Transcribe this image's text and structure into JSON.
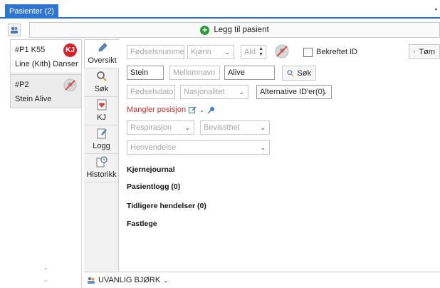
{
  "tab": {
    "label": "Pasienter (2)"
  },
  "toolbar": {
    "add_patient_label": "Legg til pasient"
  },
  "patients": [
    {
      "id": "#P1 K55",
      "name": "Line (Kith) Danser",
      "badge": "KJ"
    },
    {
      "id": "#P2",
      "name": "Stein Alive",
      "badge": "no-position"
    }
  ],
  "nav": [
    {
      "label": "Oversikt",
      "icon": "pencil-icon"
    },
    {
      "label": "Søk",
      "icon": "magnifier-icon"
    },
    {
      "label": "KJ",
      "icon": "heart-document-icon"
    },
    {
      "label": "Logg",
      "icon": "edit-document-icon"
    },
    {
      "label": "Historikk",
      "icon": "history-icon"
    }
  ],
  "form": {
    "fodselsnummer_placeholder": "Fødselsnummer",
    "kjonn_placeholder": "Kjønn",
    "alder_placeholder": "Ald",
    "bekreftet_label": "Bekreftet ID",
    "tom_label": "Tøm",
    "fornavn_value": "Stein",
    "mellomnavn_placeholder": "Mellomnavn",
    "etternavn_value": "Alive",
    "sok_label": "Søk",
    "fodselsdato_placeholder": "Fødselsdato",
    "nasjonalitet_placeholder": "Nasjonalitet",
    "alt_ids_label": "Alternative ID'er(0)",
    "mangler_posisjon": "Mangler posisjon",
    "respirasjon_placeholder": "Respirasjon",
    "bevissthet_placeholder": "Bevissthet",
    "henvendelse_placeholder": "Henvendelse"
  },
  "sections": [
    "Kjernejournal",
    "Pasientlogg (0)",
    "Tidligere hendelser (0)",
    "Fastlege"
  ],
  "bottom": {
    "team_label": "UVANLIG BJØRK"
  },
  "colors": {
    "accent": "#2f74d0",
    "warning": "#d12b2b",
    "kj_badge": "#d9202a",
    "add_green": "#2e9b3e"
  }
}
